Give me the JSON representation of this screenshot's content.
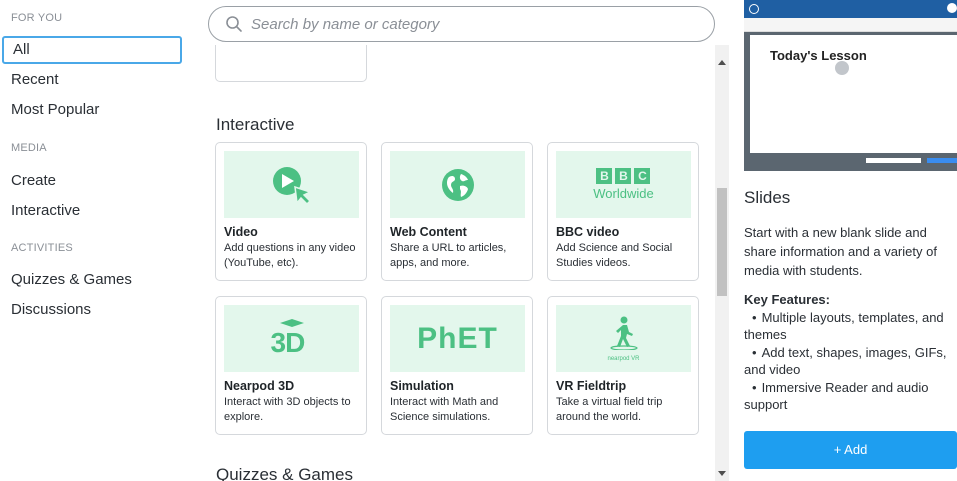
{
  "sidebar": {
    "for_you_head": "FOR YOU",
    "all": "All",
    "recent": "Recent",
    "most_popular": "Most Popular",
    "media_head": "MEDIA",
    "create": "Create",
    "interactive": "Interactive",
    "activities_head": "ACTIVITIES",
    "quizzes_games": "Quizzes & Games",
    "discussions": "Discussions"
  },
  "search": {
    "placeholder": "Search by name or category"
  },
  "main": {
    "interactive_title": "Interactive",
    "quizzes_title": "Quizzes & Games",
    "cards": [
      {
        "title": "Video",
        "desc": "Add questions in any video (YouTube, etc).",
        "icon": "video-play-icon"
      },
      {
        "title": "Web Content",
        "desc": "Share a URL to articles, apps, and more.",
        "icon": "globe-icon"
      },
      {
        "title": "BBC video",
        "desc": "Add Science and Social Studies videos.",
        "icon": "bbc-worldwide-logo",
        "logo_letters": [
          "B",
          "B",
          "C"
        ],
        "logo_sub": "Worldwide"
      },
      {
        "title": "Nearpod 3D",
        "desc": "Interact with 3D objects to explore.",
        "icon": "3d-logo",
        "logo_text": "3D"
      },
      {
        "title": "Simulation",
        "desc": "Interact with Math and Science simulations.",
        "icon": "phet-logo",
        "logo_text": "PhET"
      },
      {
        "title": "VR Fieldtrip",
        "desc": "Take a virtual field trip around the world.",
        "icon": "vr-walker-icon",
        "logo_sub": "nearpod VR"
      }
    ]
  },
  "panel": {
    "preview_title": "Today's Lesson",
    "title": "Slides",
    "desc": "Start with a new blank slide and share information and a variety of media with students.",
    "features_head": "Key Features:",
    "features": [
      "Multiple layouts, templates, and themes",
      "Add text, shapes, images, GIFs, and video",
      "Immersive Reader and audio support"
    ],
    "add_label": "+ Add"
  },
  "colors": {
    "accent": "#1e9ef0",
    "thumb_bg": "#e3f7ec",
    "thumb_icon": "#4cc083",
    "active_border": "#4aa8e8"
  }
}
